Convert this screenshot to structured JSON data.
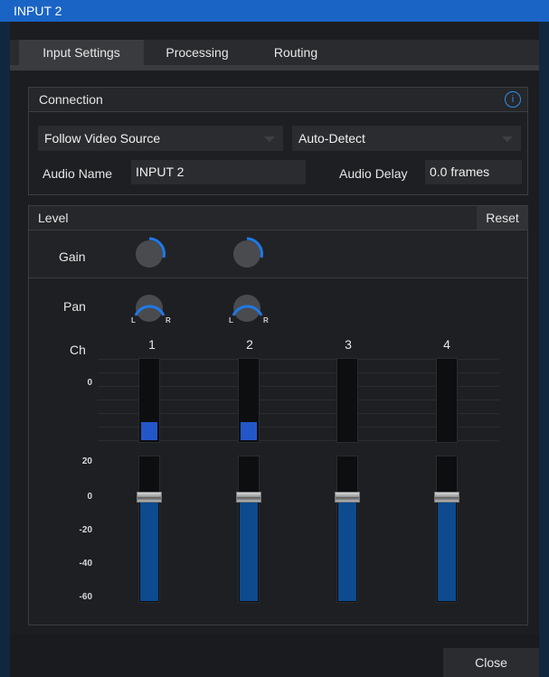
{
  "window": {
    "title": "INPUT 2",
    "accent": "#1a64c6"
  },
  "tabs": [
    {
      "label": "Input Settings",
      "active": true
    },
    {
      "label": "Processing",
      "active": false
    },
    {
      "label": "Routing",
      "active": false
    }
  ],
  "connection": {
    "heading": "Connection",
    "info_icon": "info-icon",
    "info_glyph": "i",
    "source_select": "Follow Video Source",
    "format_select": "Auto-Detect",
    "audio_name_label": "Audio Name",
    "audio_name_value": "INPUT 2",
    "audio_delay_label": "Audio Delay",
    "audio_delay_value": "0.0 frames"
  },
  "level": {
    "heading": "Level",
    "reset_label": "Reset",
    "gain_label": "Gain",
    "pan_label": "Pan",
    "pan_left": "L",
    "pan_right": "R",
    "ch_label": "Ch",
    "channels": [
      "1",
      "2",
      "3",
      "4"
    ],
    "meter_scale": [
      "0"
    ],
    "fader_scale": [
      "20",
      "0",
      "-20",
      "-40",
      "-60"
    ],
    "meter_levels": [
      0.23,
      0.23,
      0,
      0
    ],
    "fader_db": [
      0,
      0,
      0,
      0
    ]
  },
  "footer": {
    "close_label": "Close"
  }
}
